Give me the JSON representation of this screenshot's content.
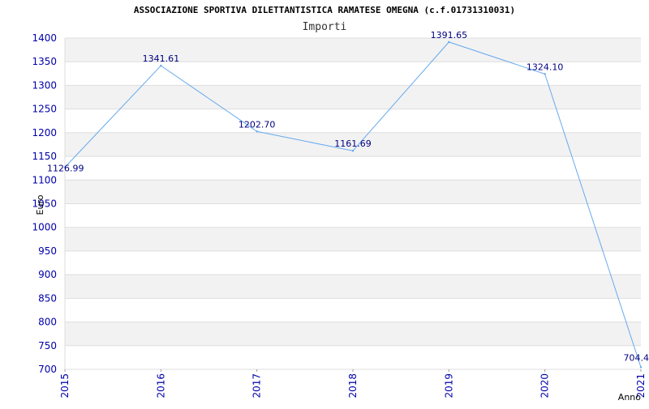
{
  "chart_data": {
    "type": "line",
    "title": "ASSOCIAZIONE SPORTIVA DILETTANTISTICA RAMATESE OMEGNA (c.f.01731310031)",
    "subtitle": "Importi",
    "xlabel": "Anno",
    "ylabel": "Euro",
    "x": [
      "2015",
      "2016",
      "2017",
      "2018",
      "2019",
      "2020",
      "2021"
    ],
    "series": [
      {
        "values": [
          1126.99,
          1341.61,
          1202.7,
          1161.69,
          1391.65,
          1324.1,
          704.4
        ]
      }
    ],
    "data_labels": [
      "1126.99",
      "1341.61",
      "1202.70",
      "1161.69",
      "1391.65",
      "1324.10",
      "704.4"
    ],
    "ylim": [
      700,
      1400
    ],
    "yticks": [
      "700",
      "750",
      "800",
      "850",
      "900",
      "950",
      "1000",
      "1050",
      "1100",
      "1150",
      "1200",
      "1250",
      "1300",
      "1350",
      "1400"
    ],
    "grid": "horizontal alternating bands",
    "colors": {
      "line": "#66aaee",
      "band": "#f2f2f2",
      "grid": "#dddddd",
      "tick_text": "#0000aa",
      "data_label": "#000080"
    }
  }
}
